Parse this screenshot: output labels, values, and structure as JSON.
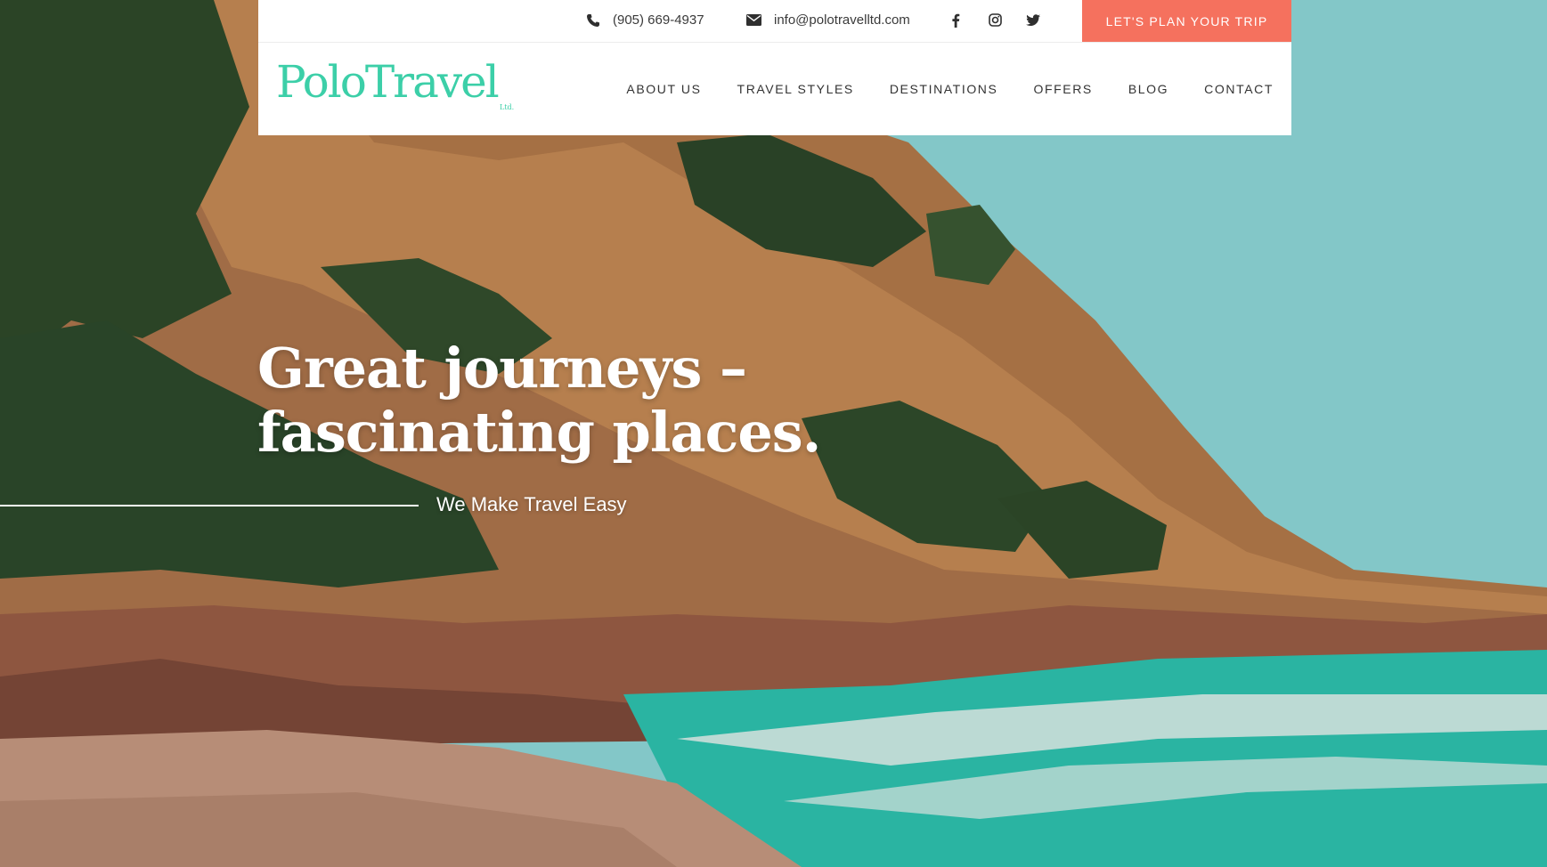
{
  "brand": {
    "logo_text": "PoloTravel",
    "logo_sub": "Ltd.",
    "accent_color": "#3ccfa8",
    "cta_color": "#f5715e"
  },
  "topbar": {
    "phone": "(905) 669-4937",
    "email": "info@polotravelltd.com",
    "social_icons": [
      "facebook-icon",
      "instagram-icon",
      "twitter-icon"
    ],
    "cta_label": "LET'S PLAN YOUR TRIP"
  },
  "nav": {
    "items": [
      {
        "label": "ABOUT US"
      },
      {
        "label": "TRAVEL STYLES"
      },
      {
        "label": "DESTINATIONS"
      },
      {
        "label": "OFFERS"
      },
      {
        "label": "BLOG"
      },
      {
        "label": "CONTACT"
      }
    ]
  },
  "hero": {
    "headline_line1": "Great journeys –",
    "headline_line2": "fascinating places.",
    "tagline": "We Make Travel Easy"
  }
}
